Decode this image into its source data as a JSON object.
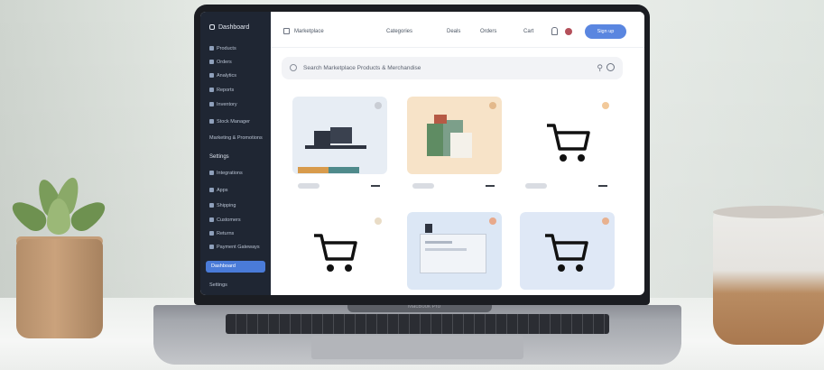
{
  "sidebar": {
    "logo": "Dashboard",
    "items": [
      {
        "label": "Products"
      },
      {
        "label": "Orders"
      },
      {
        "label": "Analytics"
      },
      {
        "label": "Reports"
      },
      {
        "label": "Inventory"
      },
      {
        "label": "Stock Manager"
      },
      {
        "label": "Marketing & Promotions"
      }
    ],
    "section": "Settings",
    "sub_items": [
      {
        "label": "Integrations"
      },
      {
        "label": "Apps"
      },
      {
        "label": "Shipping"
      },
      {
        "label": "Customers"
      },
      {
        "label": "Returns"
      },
      {
        "label": "Payment Gateways"
      }
    ],
    "active_label": "Dashboard",
    "footer_label": "Settings"
  },
  "topbar": {
    "title": "Marketplace",
    "links": [
      "Categories",
      "Deals",
      "Orders",
      "Cart"
    ],
    "primary_button": "Sign up"
  },
  "search": {
    "placeholder": "Search Marketplace Products & Merchandise"
  },
  "hinge": {
    "label": "MacBook Pro"
  },
  "colors": {
    "accent": "#5a86e0",
    "sidebar": "#1f2633"
  },
  "cards": [
    {
      "kind": "laptops",
      "bg": "#e7edf4",
      "dot": "#c9cdd4"
    },
    {
      "kind": "bags",
      "bg": "#f7e3c8",
      "dot": "#e3b98c"
    },
    {
      "kind": "cart",
      "bg": "#ffffff",
      "dot": "#f2c99a"
    },
    {
      "kind": "cart",
      "bg": "#ffffff",
      "dot": "#e9dcc6"
    },
    {
      "kind": "window",
      "bg": "#dce7f5",
      "dot": "#e8a98b"
    },
    {
      "kind": "cart",
      "bg": "#dfe8f6",
      "dot": "#e8b18f"
    }
  ]
}
